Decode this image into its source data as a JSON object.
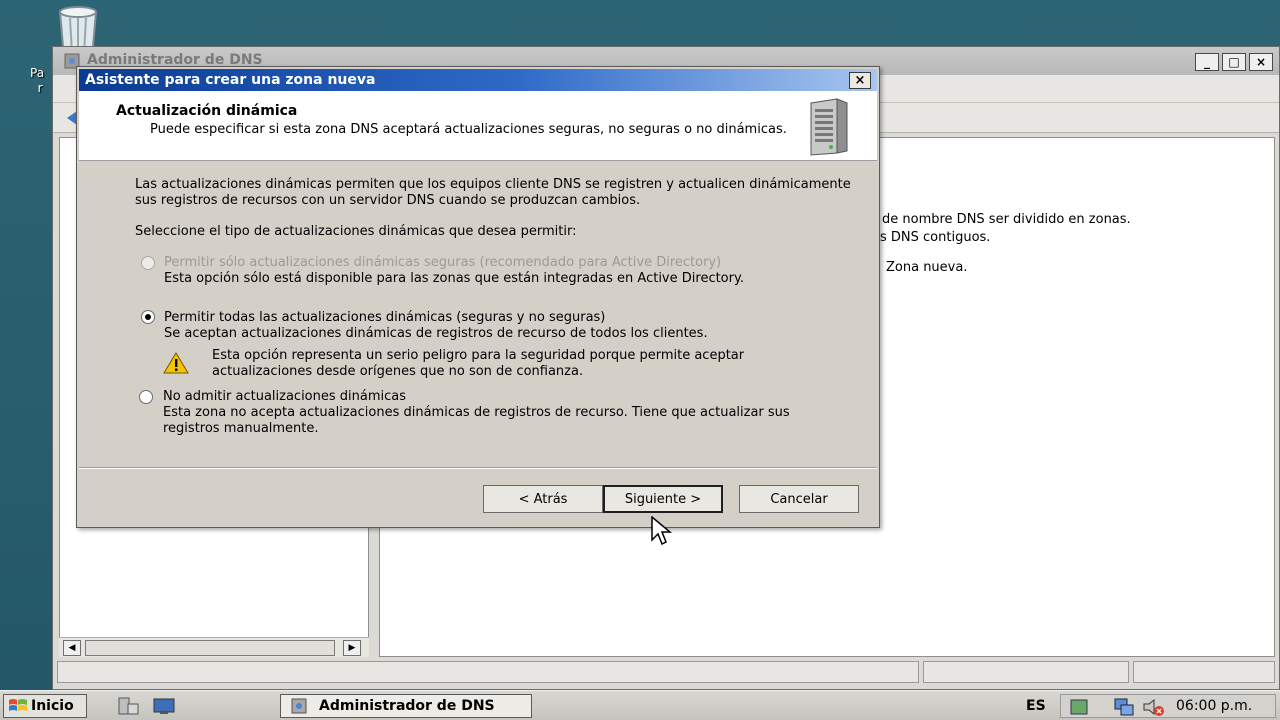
{
  "desktop": {
    "icon_label_fragment": "Pa\nr"
  },
  "mmc": {
    "title": "Administrador de DNS",
    "right_pane_lines": [
      "de nombre DNS ser dividido en zonas.",
      "s DNS contiguos.",
      "Zona nueva."
    ],
    "controls": {
      "minimize": "_",
      "maximize": "□",
      "close": "×"
    }
  },
  "wizard": {
    "title": "Asistente para crear una zona nueva",
    "close": "×",
    "header_title": "Actualización dinámica",
    "header_desc": "Puede especificar si esta zona DNS aceptará actualizaciones seguras, no seguras o no dinámicas.",
    "intro": "Las actualizaciones dinámicas permiten que los equipos cliente DNS se registren y actualicen dinámicamente sus registros de recursos con un servidor DNS cuando se produzcan cambios.",
    "prompt": "Seleccione el tipo de actualizaciones dinámicas que desea permitir:",
    "options": [
      {
        "label": "Permitir sólo actualizaciones dinámicas seguras (recomendado para Active Directory)",
        "desc": "Esta opción sólo está disponible para las zonas que están integradas en Active Directory.",
        "checked": false,
        "disabled": true
      },
      {
        "label": "Permitir todas las actualizaciones dinámicas (seguras y no seguras)",
        "desc": "Se aceptan actualizaciones dinámicas de registros de recurso de todos los clientes.",
        "warning": "Esta opción representa un serio peligro para la seguridad porque permite aceptar actualizaciones desde orígenes que no son de confianza.",
        "checked": true,
        "disabled": false
      },
      {
        "label": "No admitir actualizaciones dinámicas",
        "desc": "Esta zona no acepta actualizaciones dinámicas de registros de recurso. Tiene que actualizar sus registros manualmente.",
        "checked": false,
        "disabled": false
      }
    ],
    "buttons": {
      "back": "< Atrás",
      "next": "Siguiente >",
      "cancel": "Cancelar"
    }
  },
  "taskbar": {
    "start": "Inicio",
    "task_button": "Administrador de DNS",
    "language": "ES",
    "clock": "06:00 p.m."
  },
  "colors": {
    "desktop": "#2a5f6f",
    "titlebar_start": "#0b3b93",
    "titlebar_end": "#a7c6f0",
    "dialog_bg": "#d4d0c8"
  }
}
